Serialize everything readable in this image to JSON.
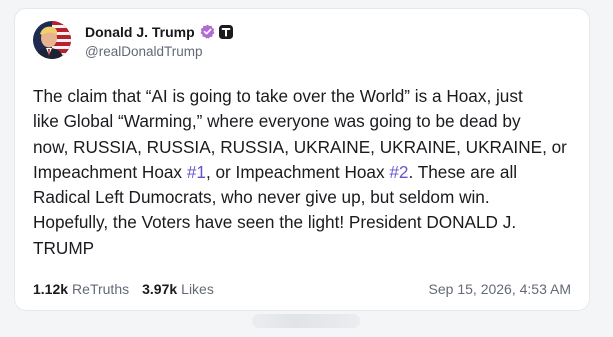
{
  "post": {
    "author": {
      "display_name": "Donald J. Trump",
      "handle": "@realDonaldTrump",
      "verified_icon": "verified-badge-icon",
      "platform_icon": "truth-social-icon",
      "accent_color": "#b06cd6"
    },
    "text_lines": [
      [
        "The claim that “AI is going to take over the World” is a Hoax, just"
      ],
      [
        "like Global “Warming,” where everyone was going to be dead by"
      ],
      [
        "now, RUSSIA, RUSSIA, RUSSIA, UKRAINE, UKRAINE, UKRAINE, or"
      ],
      [
        "Impeachment Hoax ",
        "#1",
        ", or Impeachment Hoax ",
        "#2",
        ". These are all"
      ],
      [
        "Radical Left Dumocrats, who never give up, but seldom win."
      ],
      [
        "Hopefully, the Voters have seen the light! President DONALD J."
      ],
      [
        "TRUMP"
      ]
    ],
    "hashtag_color": "#6b51d0",
    "stats": {
      "retruths_count": "1.12k",
      "retruths_label": "ReTruths",
      "likes_count": "3.97k",
      "likes_label": "Likes"
    },
    "timestamp": "Sep 15, 2026, 4:53 AM"
  }
}
